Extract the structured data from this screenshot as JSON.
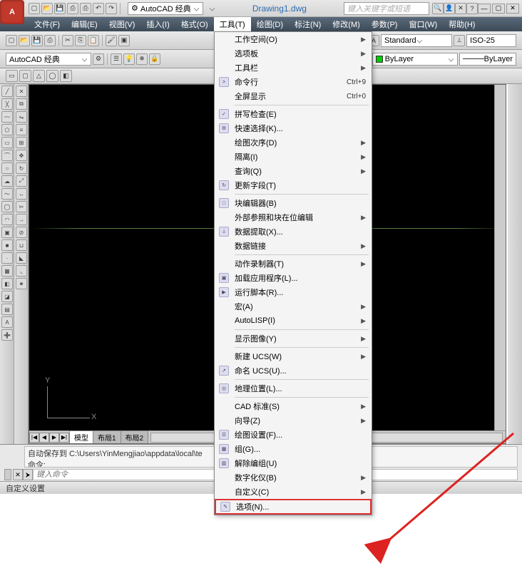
{
  "app": {
    "logo_letter": "A",
    "title": "Drawing1.dwg"
  },
  "search": {
    "placeholder": "键入关键字或短语"
  },
  "workspace_combo": {
    "label": "AutoCAD 经典"
  },
  "win_buttons": {
    "min": "—",
    "max": "▢",
    "close": "✕"
  },
  "menubar": [
    {
      "label": "文件(F)"
    },
    {
      "label": "编辑(E)"
    },
    {
      "label": "视图(V)"
    },
    {
      "label": "插入(I)"
    },
    {
      "label": "格式(O)"
    },
    {
      "label": "工具(T)",
      "active": true
    },
    {
      "label": "绘图(D)"
    },
    {
      "label": "标注(N)"
    },
    {
      "label": "修改(M)"
    },
    {
      "label": "参数(P)"
    },
    {
      "label": "窗口(W)"
    },
    {
      "label": "帮助(H)"
    }
  ],
  "toolbar2": {
    "workspace": "AutoCAD 经典",
    "style_combo1": "Standard",
    "style_combo2": "ISO-25"
  },
  "toolbar3": {
    "layer_combo": "ByLayer",
    "right_combo": "ByLayer"
  },
  "tabs": {
    "nav": [
      "|◀",
      "◀",
      "▶",
      "▶|"
    ],
    "model": "模型",
    "layout1": "布局1",
    "layout2": "布局2"
  },
  "ucs": {
    "x": "X",
    "y": "Y"
  },
  "cmd": {
    "history_line1": "自动保存到 C:\\Users\\YinMengjiao\\appdata\\local\\te",
    "history_line2": "命令:",
    "placeholder": "键入命令",
    "prompt_glyph": "⮞"
  },
  "statusbar": {
    "text": "自定义设置"
  },
  "dropdown": [
    {
      "label": "工作空间(O)",
      "submenu": true
    },
    {
      "label": "选项板",
      "submenu": true
    },
    {
      "label": "工具栏",
      "submenu": true
    },
    {
      "label": "命令行",
      "shortcut": "Ctrl+9",
      "icon": ">"
    },
    {
      "label": "全屏显示",
      "shortcut": "Ctrl+0"
    },
    {
      "sep": true
    },
    {
      "label": "拼写检查(E)",
      "icon": "✓"
    },
    {
      "label": "快速选择(K)...",
      "icon": "⚙"
    },
    {
      "label": "绘图次序(D)",
      "submenu": true
    },
    {
      "label": "隔离(I)",
      "submenu": true
    },
    {
      "label": "查询(Q)",
      "submenu": true
    },
    {
      "label": "更新字段(T)",
      "icon": "↻"
    },
    {
      "sep": true
    },
    {
      "label": "块编辑器(B)",
      "icon": "□"
    },
    {
      "label": "外部参照和块在位编辑",
      "submenu": true
    },
    {
      "label": "数据提取(X)...",
      "icon": "⤓"
    },
    {
      "label": "数据链接",
      "submenu": true
    },
    {
      "sep": true
    },
    {
      "label": "动作录制器(T)",
      "submenu": true
    },
    {
      "label": "加载应用程序(L)...",
      "icon": "▣"
    },
    {
      "label": "运行脚本(R)...",
      "icon": "▶"
    },
    {
      "label": "宏(A)",
      "submenu": true
    },
    {
      "label": "AutoLISP(I)",
      "submenu": true
    },
    {
      "sep": true
    },
    {
      "label": "显示图像(Y)",
      "submenu": true
    },
    {
      "sep": true
    },
    {
      "label": "新建 UCS(W)",
      "submenu": true
    },
    {
      "label": "命名 UCS(U)...",
      "icon": "↗"
    },
    {
      "sep": true
    },
    {
      "label": "地理位置(L)...",
      "icon": "◎"
    },
    {
      "sep": true
    },
    {
      "label": "CAD 标准(S)",
      "submenu": true
    },
    {
      "label": "向导(Z)",
      "submenu": true
    },
    {
      "label": "绘图设置(F)...",
      "icon": "☰"
    },
    {
      "label": "组(G)...",
      "icon": "▦"
    },
    {
      "label": "解除编组(U)",
      "icon": "▥"
    },
    {
      "label": "数字化仪(B)",
      "submenu": true
    },
    {
      "label": "自定义(C)",
      "submenu": true
    },
    {
      "label": "选项(N)...",
      "icon": "✎",
      "highlight": true
    }
  ]
}
